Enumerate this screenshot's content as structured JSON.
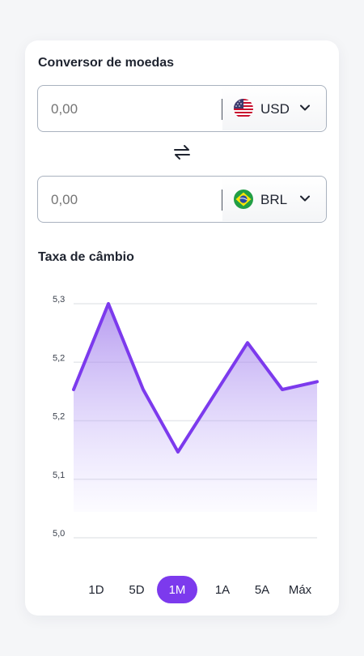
{
  "converter": {
    "title": "Conversor de moedas",
    "from": {
      "placeholder": "0,00",
      "currency": "USD",
      "flag": "us-flag-icon"
    },
    "to": {
      "placeholder": "0,00",
      "currency": "BRL",
      "flag": "br-flag-icon"
    }
  },
  "rate": {
    "title": "Taxa de câmbio"
  },
  "chart_data": {
    "type": "area",
    "ylim": [
      5.0,
      5.3
    ],
    "y_tick_values": [
      5.3,
      5.225,
      5.15,
      5.075,
      5.0
    ],
    "y_tick_labels": [
      "5,3",
      "5,2",
      "5,2",
      "5,1",
      "5,0"
    ],
    "grid": true,
    "series": [
      {
        "values": [
          5.19,
          5.3,
          5.19,
          5.11,
          5.18,
          5.25,
          5.19,
          5.2
        ]
      }
    ],
    "line_color": "#7c3aed",
    "fill_color": "#b79af2"
  },
  "ranges": {
    "items": [
      "1D",
      "5D",
      "1M",
      "1A",
      "5A",
      "Máx"
    ],
    "active_index": 2
  },
  "colors": {
    "accent": "#7c3aed",
    "border": "#a9b2bf"
  }
}
